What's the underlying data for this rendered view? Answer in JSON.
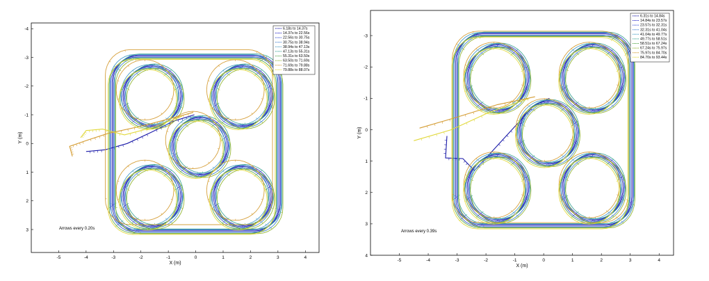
{
  "chart_data": [
    {
      "type": "line",
      "xlabel": "X (m)",
      "ylabel": "Y (m)",
      "xlim": [
        -6,
        4.5
      ],
      "ylim": [
        -4.2,
        3.8
      ],
      "y_reversed": true,
      "x_ticks": [
        -5,
        -4,
        -3,
        -2,
        -1,
        0,
        1,
        2,
        3,
        4
      ],
      "y_ticks": [
        -4,
        -3,
        -2,
        -1,
        0,
        1,
        2,
        3
      ],
      "grid": false,
      "legend_position": "top-right",
      "annotation": "Arrows every 0.20s",
      "series": [
        {
          "name": "6.18s to 14.37s",
          "color": "#1a1aa8",
          "offset": [
            0.0,
            0.0
          ],
          "lead_in": [
            [
              -4.0,
              0.28
            ],
            [
              -3.3,
              0.22
            ],
            [
              -2.5,
              0.0
            ],
            [
              -1.6,
              -0.4
            ],
            [
              -0.8,
              -0.78
            ],
            [
              -0.05,
              -1.0
            ]
          ]
        },
        {
          "name": "14.37s to 22.56s",
          "color": "#2b2bc9",
          "offset": [
            0.04,
            -0.03
          ]
        },
        {
          "name": "22.56s to 30.75s",
          "color": "#3a52d6",
          "offset": [
            -0.05,
            0.04
          ]
        },
        {
          "name": "30.75s to 38.94s",
          "color": "#3d7fd0",
          "offset": [
            0.07,
            0.05
          ]
        },
        {
          "name": "38.94s to 47.13s",
          "color": "#3f98c6",
          "offset": [
            -0.08,
            -0.05
          ]
        },
        {
          "name": "47.13s to 55.31s",
          "color": "#3aa395",
          "offset": [
            0.1,
            -0.07
          ]
        },
        {
          "name": "55.31s to 63.50s",
          "color": "#56a84a",
          "offset": [
            -0.11,
            0.08
          ]
        },
        {
          "name": "63.50s to 71.69s",
          "color": "#8fb32f",
          "offset": [
            0.13,
            0.09
          ]
        },
        {
          "name": "71.69s to 79.88s",
          "color": "#d49b30",
          "offset": [
            -0.25,
            -0.22
          ],
          "lead_in": [
            [
              -4.5,
              0.45
            ],
            [
              -4.6,
              0.1
            ],
            [
              -4.0,
              -0.1
            ],
            [
              -3.2,
              -0.35
            ],
            [
              -2.0,
              -0.6
            ],
            [
              -1.0,
              -0.85
            ],
            [
              -0.1,
              -1.08
            ]
          ]
        },
        {
          "name": "79.88s to 88.07s",
          "color": "#e1d83a",
          "offset": [
            -0.15,
            0.12
          ],
          "lead_in": [
            [
              -4.2,
              -0.2
            ],
            [
              -4.0,
              -0.45
            ],
            [
              -3.4,
              -0.5
            ],
            [
              -2.6,
              -0.3
            ],
            [
              -1.6,
              -0.55
            ],
            [
              -0.5,
              -0.95
            ]
          ]
        }
      ]
    },
    {
      "type": "line",
      "xlabel": "X (m)",
      "ylabel": "Y (m)",
      "xlim": [
        -6,
        4.5
      ],
      "ylim": [
        -3.8,
        4.0
      ],
      "y_reversed": true,
      "x_ticks": [
        -5,
        -4,
        -3,
        -2,
        -1,
        0,
        1,
        2,
        3,
        4
      ],
      "y_ticks": [
        -3,
        -2,
        -1,
        0,
        1,
        2,
        3,
        4
      ],
      "grid": false,
      "legend_position": "top-right",
      "annotation": "Arrows every 0.39s",
      "series": [
        {
          "name": "6.31s to 14.84s",
          "color": "#1a1aa8",
          "offset": [
            0.0,
            0.0
          ],
          "lead_in": [
            [
              -3.35,
              0.2
            ],
            [
              -3.4,
              0.9
            ],
            [
              -2.8,
              0.92
            ],
            [
              -2.4,
              1.3
            ],
            [
              -1.7,
              0.6
            ],
            [
              -1.0,
              -0.1
            ],
            [
              -0.3,
              -0.8
            ],
            [
              0.2,
              -1.0
            ]
          ]
        },
        {
          "name": "14.84s to 23.57s",
          "color": "#2b2bc9",
          "offset": [
            0.04,
            -0.03
          ]
        },
        {
          "name": "23.57s to 32.31s",
          "color": "#3a52d6",
          "offset": [
            -0.05,
            0.04
          ]
        },
        {
          "name": "32.31s to 41.04s",
          "color": "#3d7fd0",
          "offset": [
            0.07,
            0.05
          ]
        },
        {
          "name": "41.04s to 49.77s",
          "color": "#3f98c6",
          "offset": [
            -0.06,
            -0.05
          ]
        },
        {
          "name": "49.77s to 58.51s",
          "color": "#3aa395",
          "offset": [
            0.09,
            -0.06
          ]
        },
        {
          "name": "58.51s to 67.24s",
          "color": "#56a84a",
          "offset": [
            -0.09,
            0.07
          ]
        },
        {
          "name": "67.24s to 75.97s",
          "color": "#8fb32f",
          "offset": [
            0.11,
            0.08
          ]
        },
        {
          "name": "75.97s to 84.70s",
          "color": "#d49b30",
          "offset": [
            -0.12,
            -0.09
          ],
          "lead_in": [
            [
              -4.3,
              -0.05
            ],
            [
              -3.0,
              -0.4
            ],
            [
              -1.6,
              -0.8
            ],
            [
              -0.3,
              -1.05
            ]
          ]
        },
        {
          "name": "84.70s to 93.44s",
          "color": "#e1d83a",
          "offset": [
            -0.13,
            0.11
          ],
          "lead_in": [
            [
              -4.5,
              0.35
            ],
            [
              -3.2,
              0.0
            ],
            [
              -1.9,
              -0.55
            ],
            [
              -0.5,
              -1.0
            ]
          ]
        }
      ]
    }
  ]
}
